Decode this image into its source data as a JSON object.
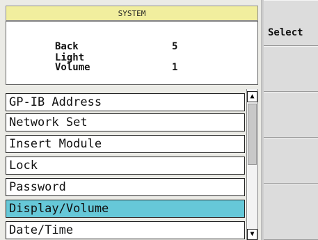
{
  "header": {
    "title": "SYSTEM"
  },
  "info": {
    "back_light_label": "Back Light",
    "back_light_value": "5",
    "volume_label": "Volume",
    "volume_value": "1"
  },
  "menu": {
    "items": [
      {
        "label": "GP-IB Address"
      },
      {
        "label": "Network Set"
      },
      {
        "label": "Insert Module"
      },
      {
        "label": "Lock"
      },
      {
        "label": "Password"
      },
      {
        "label": "Display/Volume",
        "selected": true
      },
      {
        "label": "Date/Time"
      }
    ]
  },
  "softkeys": [
    {
      "label": "Select"
    },
    {
      "label": ""
    },
    {
      "label": ""
    },
    {
      "label": ""
    },
    {
      "label": ""
    }
  ],
  "colors": {
    "header_bg": "#f1ee9e",
    "selected_bg": "#66c8d8"
  }
}
